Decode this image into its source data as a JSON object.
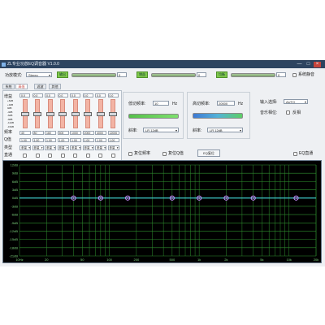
{
  "window": {
    "title": "ZL专业功放EQ调音器 V1.0.0",
    "minimize_glyph": "—",
    "maximize_glyph": "□",
    "close_glyph": "×"
  },
  "toolbar": {
    "output_mode_label": "功放模式:",
    "output_mode_value": "Stereo",
    "buttons": [
      {
        "label": "输出",
        "value": "0"
      },
      {
        "label": "增益",
        "value": "0"
      },
      {
        "label": "均衡",
        "value": "0"
      }
    ],
    "mute_label": "系统静音"
  },
  "tabs": [
    {
      "label": "系统",
      "active": false
    },
    {
      "label": "高低",
      "active": true
    },
    {
      "label": "滤波",
      "active": false
    },
    {
      "label": "其他",
      "active": false
    }
  ],
  "band_panel": {
    "side_label_gain": "增益",
    "scale_labels": [
      "+6dB",
      "+3dB",
      "0dB",
      "-3dB",
      "-6dB",
      "-9dB",
      "-12dB",
      "-15dB"
    ],
    "row_label_freq": "频率",
    "row_label_q": "Q值",
    "row_label_type": "类型",
    "row_label_bypass": "直通",
    "columns": [
      {
        "gain": "0.0",
        "freq": "40",
        "q": "1.00",
        "type": "参量",
        "level": 0.5
      },
      {
        "gain": "0.0",
        "freq": "80",
        "q": "1.00",
        "type": "参量",
        "level": 0.5
      },
      {
        "gain": "0.0",
        "freq": "160",
        "q": "1.00",
        "type": "参量",
        "level": 0.5
      },
      {
        "gain": "0.0",
        "freq": "500",
        "q": "1.00",
        "type": "参量",
        "level": 0.5
      },
      {
        "gain": "0.0",
        "freq": "1000",
        "q": "1.00",
        "type": "参量",
        "level": 0.5
      },
      {
        "gain": "0.0",
        "freq": "2000",
        "q": "1.00",
        "type": "参量",
        "level": 0.5
      },
      {
        "gain": "0.0",
        "freq": "4000",
        "q": "1.00",
        "type": "参量",
        "level": 0.5
      },
      {
        "gain": "0.0",
        "freq": "12000",
        "q": "1.00",
        "type": "参量",
        "level": 0.5
      }
    ]
  },
  "lowpass": {
    "freq_label": "低切频率:",
    "freq_value": "10",
    "unit": "Hz",
    "slope_label": "斜率:",
    "slope_value": "LR 12dB"
  },
  "highpass": {
    "freq_label": "高切频率:",
    "freq_value": "20000",
    "unit": "Hz",
    "slope_label": "斜率:",
    "slope_value": "LR 12dB"
  },
  "input": {
    "select_label": "输入选择:",
    "select_value": "AUTO",
    "phase_label": "音乐相位:",
    "phase_option": "反相"
  },
  "actions": {
    "reset_freq": "复位频率",
    "reset_q": "复位Q值",
    "eq_reset": "EQ复位",
    "eq_bypass": "EQ直通"
  },
  "graph": {
    "y_labels": [
      "12dB",
      "9dB",
      "6dB",
      "3dB",
      "0dB",
      "-3dB",
      "-6dB",
      "-9dB",
      "-12dB",
      "-15dB",
      "-18dB",
      "-21dB"
    ],
    "x_labels": [
      "10Hz",
      "20",
      "50",
      "100",
      "200",
      "500",
      "1k",
      "2k",
      "5k",
      "10k",
      "20k"
    ],
    "curve_color": "#3ec6c9",
    "grid_color": "#2f8f2f",
    "node_color": "#c98bff",
    "node_positions_hz": [
      40,
      80,
      160,
      500,
      1000,
      2000,
      4000,
      12000
    ]
  }
}
